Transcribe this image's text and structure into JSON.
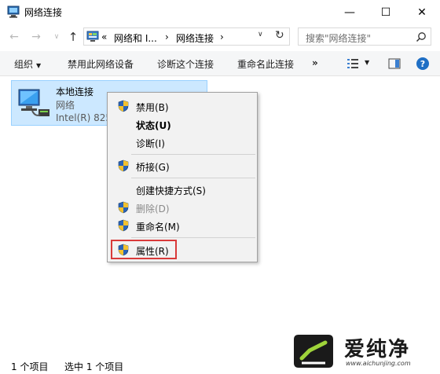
{
  "window": {
    "title": "网络连接",
    "min_symbol": "—",
    "max_symbol": "☐",
    "close_symbol": "✕"
  },
  "nav": {
    "back_symbol": "←",
    "forward_symbol": "→",
    "history_symbol": "∨",
    "up_symbol": "↑"
  },
  "address": {
    "prefix": "«",
    "crumb1": "网络和 I...",
    "sep1": "›",
    "crumb2": "网络连接",
    "sep2": "›",
    "dropdown_symbol": "∨",
    "refresh_symbol": "↻"
  },
  "search": {
    "placeholder": "搜索\"网络连接\""
  },
  "commands": {
    "organize": "组织",
    "disable_device": "禁用此网络设备",
    "diagnose": "诊断这个连接",
    "rename": "重命名此连接",
    "more": "»"
  },
  "item": {
    "name": "本地连接",
    "network": "网络",
    "device": "Intel(R) 825"
  },
  "menu": {
    "disable": "禁用(B)",
    "status": "状态(U)",
    "diagnose": "诊断(I)",
    "bridge": "桥接(G)",
    "create_shortcut": "创建快捷方式(S)",
    "delete": "删除(D)",
    "rename": "重命名(M)",
    "properties": "属性(R)"
  },
  "status": {
    "count": "1 个项目",
    "selected": "选中 1 个项目"
  },
  "watermark": {
    "name": "爱纯净",
    "url": "www.aichunjing.com"
  },
  "colors": {
    "selection_bg": "#cce8ff",
    "highlight_border": "#d93a3a",
    "accent": "#0078d7"
  }
}
